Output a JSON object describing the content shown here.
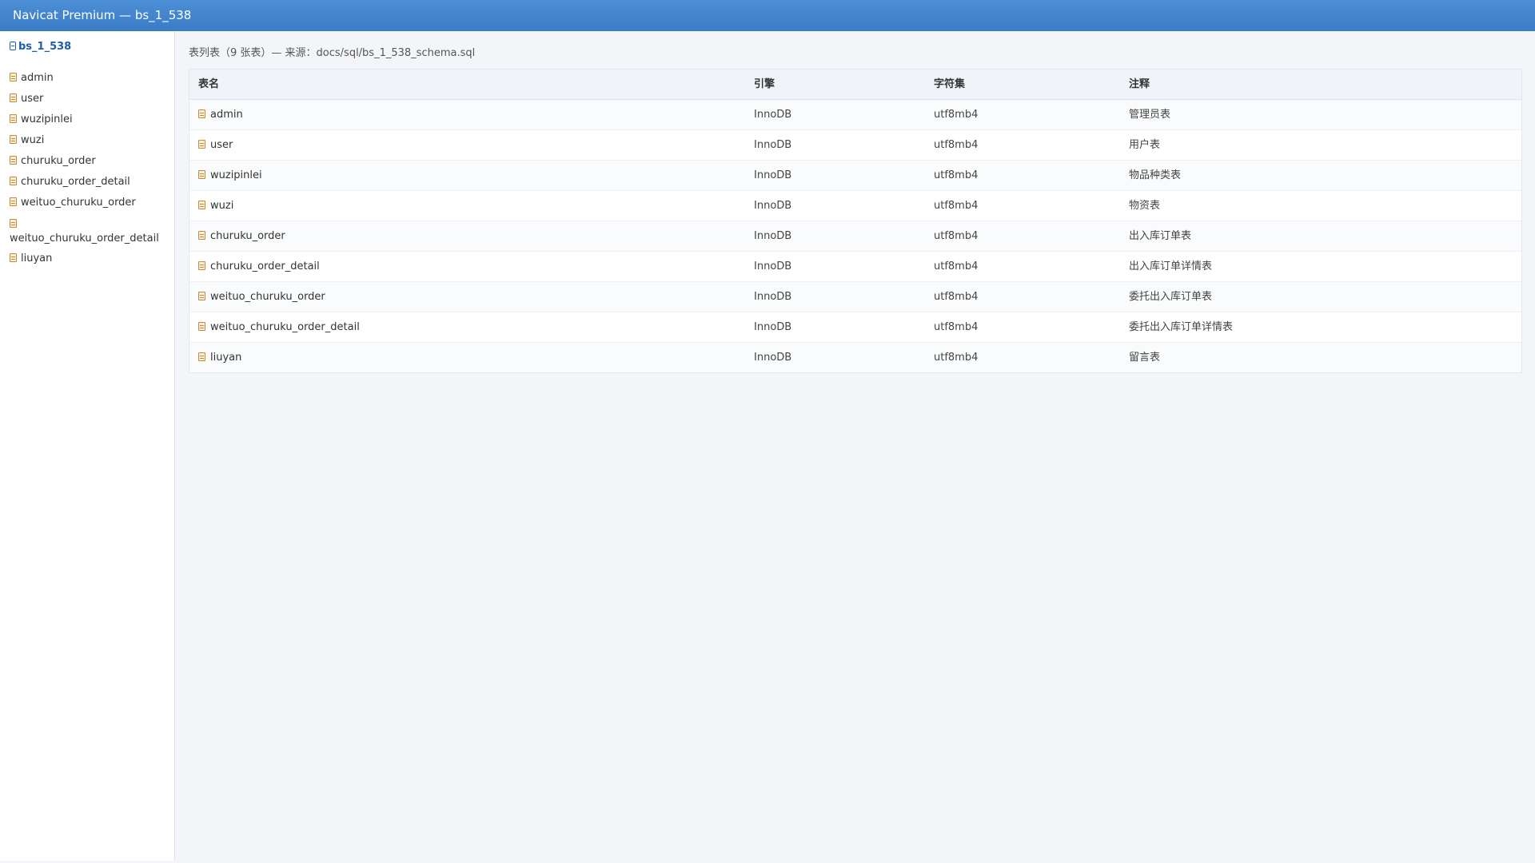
{
  "window": {
    "title": "Navicat Premium — bs_1_538"
  },
  "sidebar": {
    "database": "bs_1_538",
    "items": [
      {
        "label": "admin"
      },
      {
        "label": "user"
      },
      {
        "label": "wuzipinlei"
      },
      {
        "label": "wuzi"
      },
      {
        "label": "churuku_order"
      },
      {
        "label": "churuku_order_detail"
      },
      {
        "label": "weituo_churuku_order"
      },
      {
        "label": "weituo_churuku_order_detail"
      },
      {
        "label": "liuyan"
      }
    ]
  },
  "main": {
    "caption": "表列表（9 张表）— 来源：docs/sql/bs_1_538_schema.sql",
    "columns": {
      "name": "表名",
      "engine": "引擎",
      "charset": "字符集",
      "comment": "注释"
    },
    "rows": [
      {
        "name": "admin",
        "engine": "InnoDB",
        "charset": "utf8mb4",
        "comment": "管理员表"
      },
      {
        "name": "user",
        "engine": "InnoDB",
        "charset": "utf8mb4",
        "comment": "用户表"
      },
      {
        "name": "wuzipinlei",
        "engine": "InnoDB",
        "charset": "utf8mb4",
        "comment": "物品种类表"
      },
      {
        "name": "wuzi",
        "engine": "InnoDB",
        "charset": "utf8mb4",
        "comment": "物资表"
      },
      {
        "name": "churuku_order",
        "engine": "InnoDB",
        "charset": "utf8mb4",
        "comment": "出入库订单表"
      },
      {
        "name": "churuku_order_detail",
        "engine": "InnoDB",
        "charset": "utf8mb4",
        "comment": "出入库订单详情表"
      },
      {
        "name": "weituo_churuku_order",
        "engine": "InnoDB",
        "charset": "utf8mb4",
        "comment": "委托出入库订单表"
      },
      {
        "name": "weituo_churuku_order_detail",
        "engine": "InnoDB",
        "charset": "utf8mb4",
        "comment": "委托出入库订单详情表"
      },
      {
        "name": "liuyan",
        "engine": "InnoDB",
        "charset": "utf8mb4",
        "comment": "留言表"
      }
    ]
  },
  "icons": {
    "database": "database-icon",
    "table": "table-icon"
  }
}
